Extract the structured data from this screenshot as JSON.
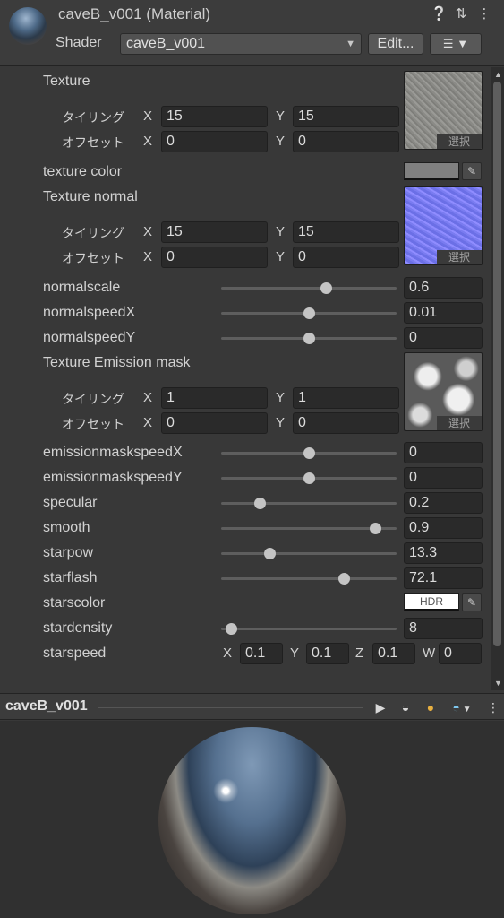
{
  "header": {
    "title": "caveB_v001 (Material)",
    "shader_label": "Shader",
    "shader_value": "caveB_v001",
    "edit_label": "Edit...",
    "help_icon": "help-icon",
    "settings_icon": "sliders-icon",
    "menu_icon": "kebab-menu-icon"
  },
  "labels": {
    "tiling": "タイリング",
    "offset": "オフセット",
    "select": "選択",
    "x": "X",
    "y": "Y",
    "z": "Z",
    "w": "W",
    "hdr": "HDR"
  },
  "texture": {
    "label": "Texture",
    "tiling_x": "15",
    "tiling_y": "15",
    "offset_x": "0",
    "offset_y": "0"
  },
  "texture_color": {
    "label": "texture color",
    "color": "#808080"
  },
  "texture_normal": {
    "label": "Texture normal",
    "tiling_x": "15",
    "tiling_y": "15",
    "offset_x": "0",
    "offset_y": "0"
  },
  "sliders": [
    {
      "label": "normalscale",
      "value": "0.6",
      "fraction": 0.6
    },
    {
      "label": "normalspeedX",
      "value": "0.01",
      "fraction": 0.5
    },
    {
      "label": "normalspeedY",
      "value": "0",
      "fraction": 0.5
    }
  ],
  "texture_emission": {
    "label": "Texture Emission mask",
    "tiling_x": "1",
    "tiling_y": "1",
    "offset_x": "0",
    "offset_y": "0"
  },
  "sliders2": [
    {
      "label": "emissionmaskspeedX",
      "value": "0",
      "fraction": 0.5
    },
    {
      "label": "emissionmaskspeedY",
      "value": "0",
      "fraction": 0.5
    },
    {
      "label": "specular",
      "value": "0.2",
      "fraction": 0.22
    },
    {
      "label": "smooth",
      "value": "0.9",
      "fraction": 0.88
    },
    {
      "label": "starpow",
      "value": "13.3",
      "fraction": 0.28
    },
    {
      "label": "starflash",
      "value": "72.1",
      "fraction": 0.7
    }
  ],
  "starscolor": {
    "label": "starscolor",
    "color": "#ffffff"
  },
  "stardensity": {
    "label": "stardensity",
    "value": "8",
    "fraction": 0.06
  },
  "starspeed": {
    "label": "starspeed",
    "x": "0.1",
    "y": "0.1",
    "z": "0.1",
    "w": "0"
  },
  "preview": {
    "title": "caveB_v001",
    "play_icon": "play-icon",
    "mesh_icon": "sphere-mesh-icon",
    "light_icon": "light-icon",
    "bg_icon": "preview-bg-icon"
  }
}
